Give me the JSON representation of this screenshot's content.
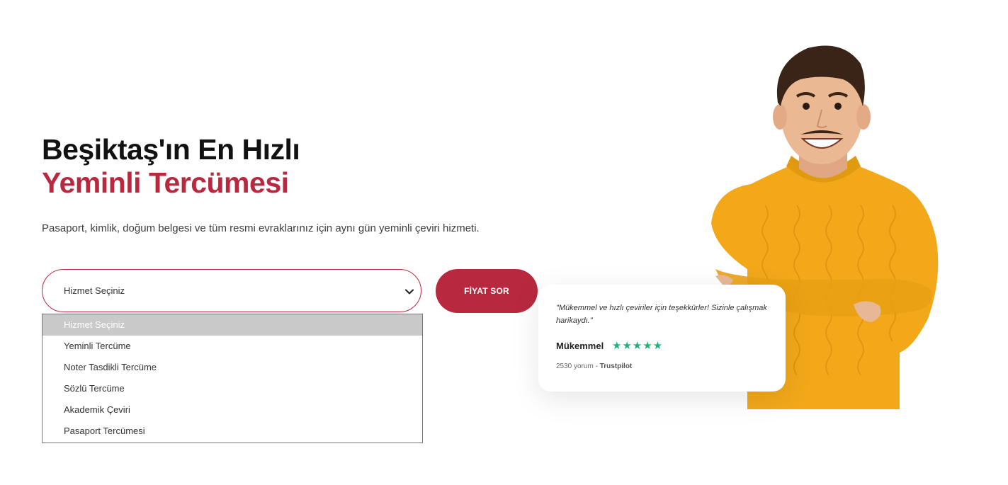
{
  "hero": {
    "title_line1": "Beşiktaş'ın En Hızlı",
    "title_line2": "Yeminli Tercümesi",
    "subtitle": "Pasaport, kimlik, doğum belgesi ve tüm resmi evraklarınız için aynı gün yeminli çeviri hizmeti."
  },
  "form": {
    "select_value": "Hizmet Seçiniz",
    "submit_label": "FİYAT SOR",
    "options": [
      "Hizmet Seçiniz",
      "Yeminli Tercüme",
      "Noter Tasdikli Tercüme",
      "Sözlü Tercüme",
      "Akademik Çeviri",
      "Pasaport Tercümesi"
    ],
    "selected_index": 0
  },
  "review": {
    "quote": "\"Mükemmel ve hızlı çeviriler için teşekkürler! Sizinle çalışmak harikaydı.\"",
    "rating_word": "Mükemmel",
    "stars": "★★★★★",
    "rating_value": 5,
    "review_count": "2530 yorum",
    "separator": " - ",
    "source": "Trustpilot"
  },
  "colors": {
    "brand": "#b8293f",
    "star": "#1db37a",
    "sweater": "#f3a81a"
  },
  "icons": {
    "select": "chevron-down-icon",
    "rating": "star-icon"
  }
}
